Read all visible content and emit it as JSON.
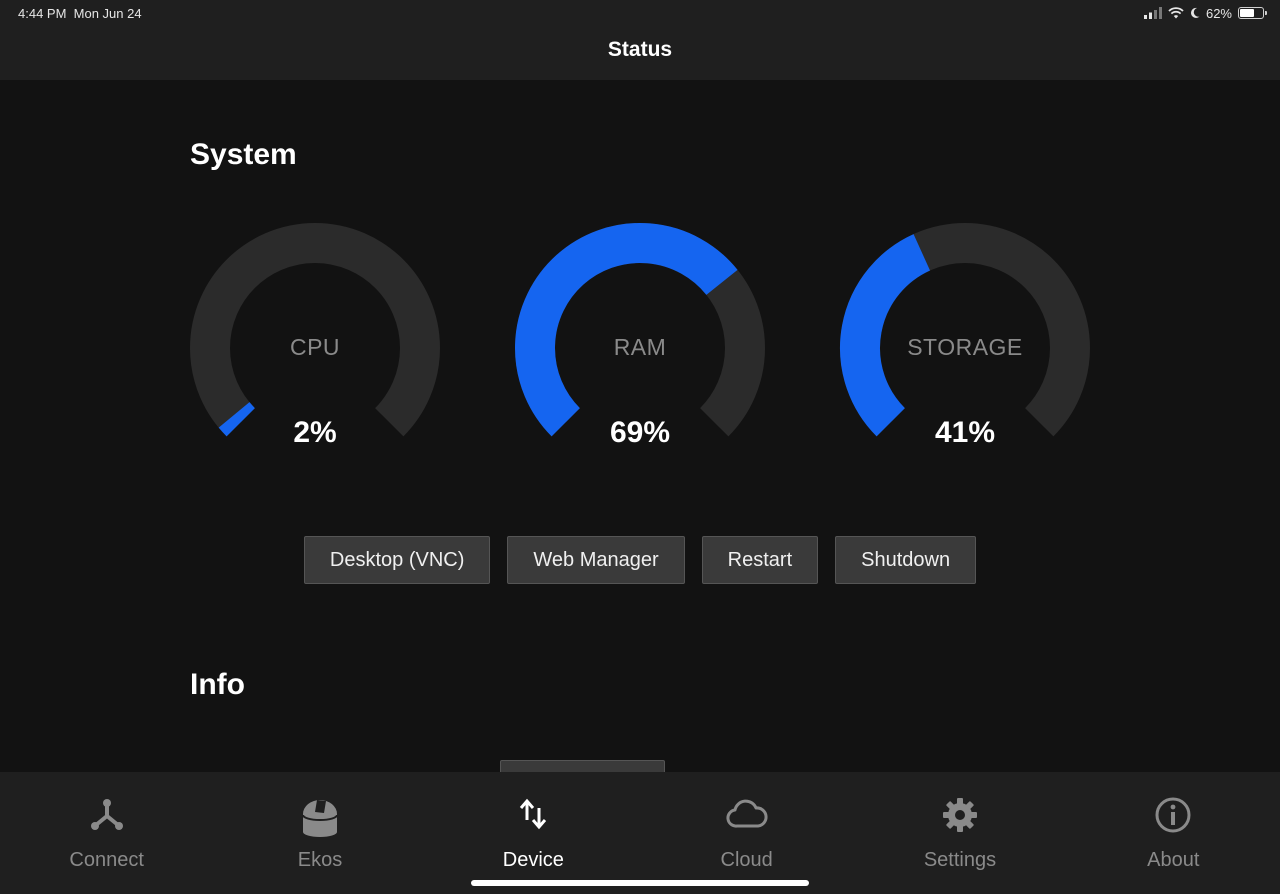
{
  "status_bar": {
    "time": "4:44 PM",
    "date": "Mon Jun 24",
    "battery_percent": "62%",
    "battery_level": 0.62
  },
  "header": {
    "title": "Status"
  },
  "system": {
    "title": "System",
    "gauges": [
      {
        "label": "CPU",
        "value_text": "2%",
        "value": 2
      },
      {
        "label": "RAM",
        "value_text": "69%",
        "value": 69
      },
      {
        "label": "STORAGE",
        "value_text": "41%",
        "value": 41
      }
    ]
  },
  "actions": {
    "vnc_label": "Desktop (VNC)",
    "web_manager_label": "Web Manager",
    "restart_label": "Restart",
    "shutdown_label": "Shutdown"
  },
  "info": {
    "title": "Info"
  },
  "tabbar": {
    "items": [
      {
        "label": "Connect",
        "icon": "connect-icon"
      },
      {
        "label": "Ekos",
        "icon": "telescope-dome-icon"
      },
      {
        "label": "Device",
        "icon": "transfer-arrows-icon"
      },
      {
        "label": "Cloud",
        "icon": "cloud-icon"
      },
      {
        "label": "Settings",
        "icon": "gear-icon"
      },
      {
        "label": "About",
        "icon": "info-icon"
      }
    ],
    "active": "Device"
  },
  "colors": {
    "accent": "#1565f0",
    "track": "#2b2b2b",
    "background": "#121212",
    "bar": "#1f1f1f"
  }
}
